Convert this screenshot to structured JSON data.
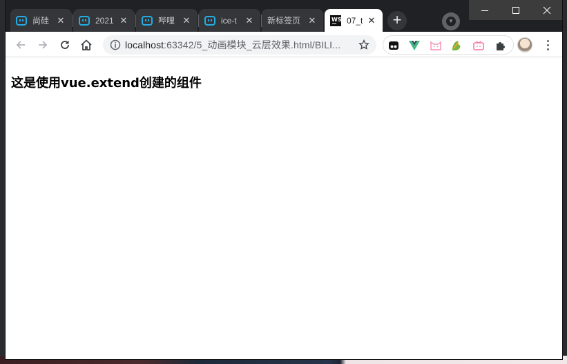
{
  "browser": {
    "tabs": [
      {
        "title": "尚硅",
        "icon": "bilibili-icon",
        "active": false
      },
      {
        "title": "2021",
        "icon": "bilibili-icon",
        "active": false
      },
      {
        "title": "哔哩",
        "icon": "bilibili-icon",
        "active": false
      },
      {
        "title": "ice-t",
        "icon": "bilibili-icon",
        "active": false
      },
      {
        "title": "新标签页",
        "icon": "none",
        "active": false
      },
      {
        "title": "07_t",
        "icon": "webstorm-icon",
        "active": true
      }
    ],
    "close_glyph": "✕",
    "new_tab_glyph": "+",
    "address": {
      "host": "localhost",
      "path": ":63342/5_动画模块_云层效果.html/BILI..."
    },
    "extensions": [
      "tampermonkey-icon",
      "vue-devtools-icon",
      "cat-icon",
      "green-extension-icon",
      "bilibili-tv-icon",
      "puzzle-icon"
    ]
  },
  "page": {
    "heading": "这是使用vue.extend创建的组件"
  },
  "colors": {
    "tabstrip": "#202124",
    "inactive_tab": "#35363a",
    "active_tab": "#ffffff",
    "bilibili_blue": "#23ade5",
    "vue_green": "#42b883"
  }
}
